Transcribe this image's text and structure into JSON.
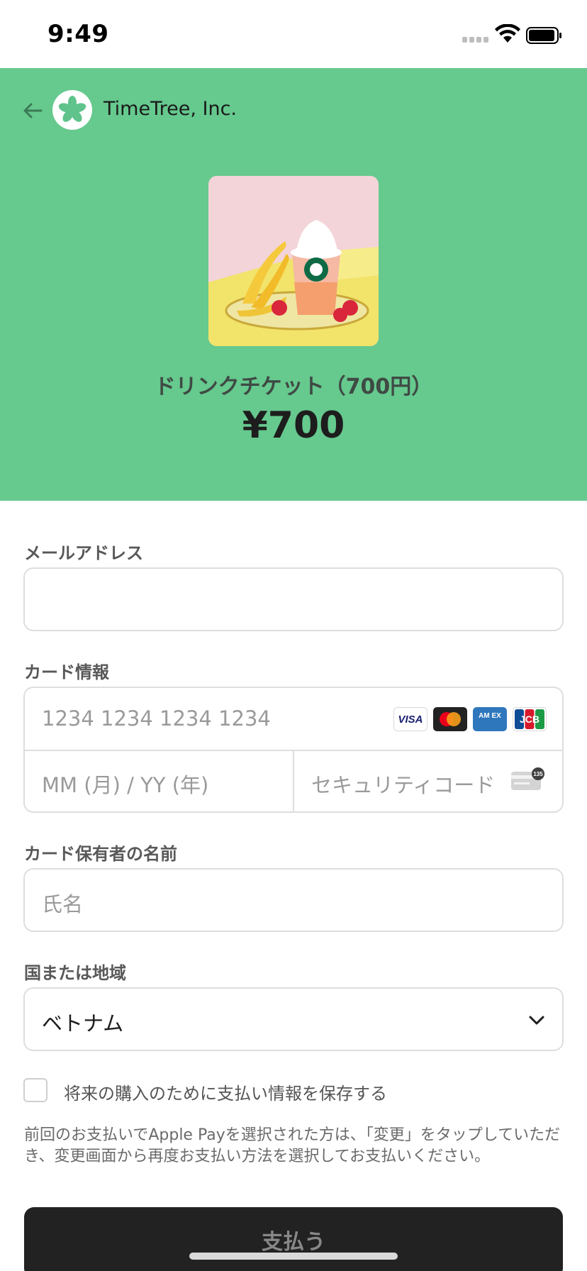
{
  "status_bar": {
    "time": "9:49"
  },
  "merchant": {
    "name": "TimeTree, Inc."
  },
  "product": {
    "title": "ドリンクチケット（700円）",
    "price": "¥700"
  },
  "form": {
    "email": {
      "label": "メールアドレス",
      "value": ""
    },
    "card": {
      "label": "カード情報",
      "number_placeholder": "1234 1234 1234 1234",
      "expiry_placeholder": "MM (月) / YY (年)",
      "cvc_placeholder": "セキュリティコード",
      "brands": [
        "visa",
        "mastercard",
        "amex",
        "jcb"
      ],
      "brand_text": {
        "visa": "VISA",
        "amex": "AM EX",
        "jcb": "JCB"
      },
      "cvc_badge": "135"
    },
    "holder": {
      "label": "カード保有者の名前",
      "placeholder": "氏名"
    },
    "country": {
      "label": "国または地域",
      "selected": "ベトナム"
    },
    "save_info": {
      "label": "将来の購入のために支払い情報を保存する",
      "checked": false
    },
    "notice": "前回のお支払いでApple Payを選択された方は、「変更」をタップしていただき、変更画面から再度お支払い方法を選択してお支払いください。"
  },
  "pay_button": {
    "label": "支払う"
  },
  "colors": {
    "hero_bg": "#66c98e",
    "button_bg": "#222222"
  }
}
